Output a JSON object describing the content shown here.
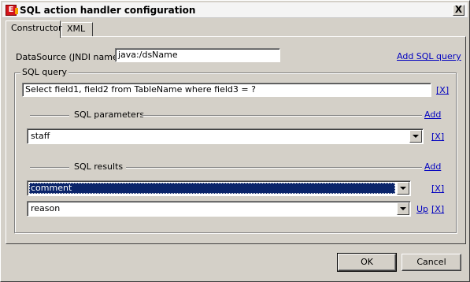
{
  "window": {
    "title": "SQL action handler configuration",
    "close_glyph": "X",
    "icon": "app-logo-icon"
  },
  "tabs": [
    {
      "label": "Constructor",
      "active": true
    },
    {
      "label": "XML",
      "active": false
    }
  ],
  "datasource": {
    "label": "DataSource (JNDI name)",
    "value": "java:/dsName",
    "add_query_link": "Add SQL query"
  },
  "sql_query": {
    "legend": "SQL query",
    "value": "Select field1, field2 from TableName where field3 = ?",
    "remove_link": "[X]",
    "parameters": {
      "label": "SQL parameters",
      "add_link": "Add",
      "items": [
        {
          "value": "staff",
          "remove_link": "[X]"
        }
      ]
    },
    "results": {
      "label": "SQL results",
      "add_link": "Add",
      "items": [
        {
          "value": "comment",
          "selected": true,
          "remove_link": "[X]"
        },
        {
          "value": "reason",
          "selected": false,
          "up_link": "Up",
          "remove_link": "[X]"
        }
      ]
    }
  },
  "buttons": {
    "ok": "OK",
    "cancel": "Cancel"
  },
  "colors": {
    "link": "#0000c0",
    "selection": "#0a246a",
    "face": "#d4d0c8"
  }
}
